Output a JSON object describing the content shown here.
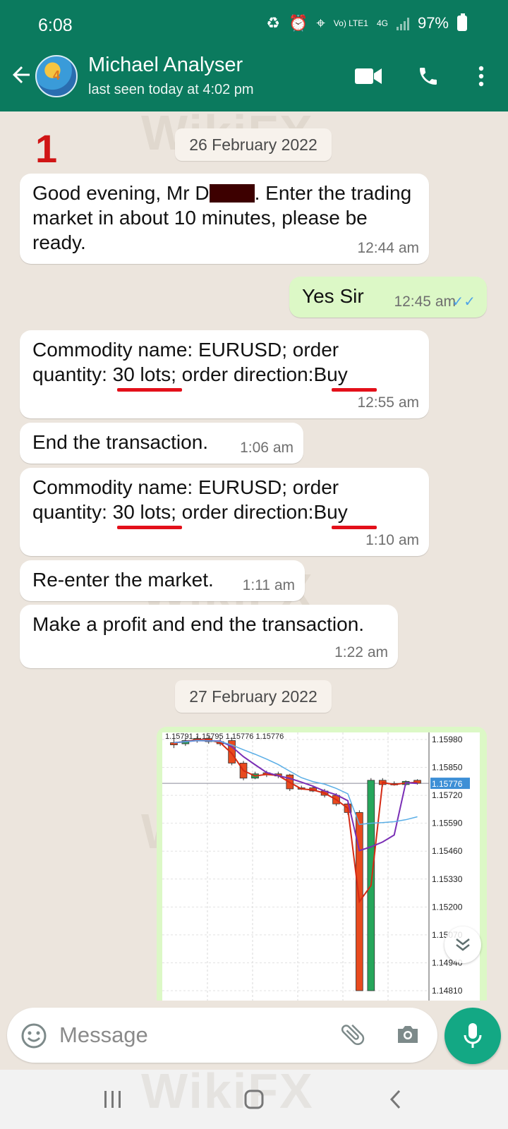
{
  "status_bar": {
    "time": "6:08",
    "battery": "97%",
    "network": "4G",
    "volte": "Vo) LTE1"
  },
  "header": {
    "contact_name": "Michael Analyser",
    "last_seen": "last seen today at 4:02 pm",
    "avatar_badge": "4"
  },
  "chat": {
    "marker": "1",
    "date1": "26 February 2022",
    "date2": "27 February 2022",
    "messages": [
      {
        "pre": "Good evening, Mr D",
        "post": ". Enter the trading market in about 10 minutes, please be ready.",
        "time": "12:44 am"
      },
      {
        "text": "Yes Sir",
        "time": "12:45 am"
      },
      {
        "line1": "Commodity name: EURUSD; order",
        "line2": "quantity: 30 lots; order direction:Buy",
        "time": "12:55 am"
      },
      {
        "text": "End the transaction.",
        "time": "1:06 am"
      },
      {
        "line1": "Commodity name: EURUSD; order",
        "line2": "quantity: 30 lots; order direction:Buy",
        "time": "1:10 am"
      },
      {
        "text": "Re-enter the market.",
        "time": "1:11 am"
      },
      {
        "text": "Make a profit and end the transaction.",
        "time": "1:22 am"
      }
    ]
  },
  "chart_data": {
    "type": "candlestick",
    "top_labels": "1.15791 1.15795 1.15776 1.15776",
    "y_ticks": [
      "1.15980",
      "1.15850",
      "1.15720",
      "1.15590",
      "1.15460",
      "1.15330",
      "1.15200",
      "1.15070",
      "1.14940",
      "1.14810"
    ],
    "current_price": "1.15776",
    "ylim": [
      1.1481,
      1.1598
    ],
    "candles": [
      {
        "o": 1.15955,
        "c": 1.15965,
        "h": 1.15985,
        "l": 1.1594,
        "dir": "down"
      },
      {
        "o": 1.1596,
        "c": 1.15975,
        "h": 1.1599,
        "l": 1.1595,
        "dir": "up"
      },
      {
        "o": 1.15975,
        "c": 1.15985,
        "h": 1.15995,
        "l": 1.15965,
        "dir": "up"
      },
      {
        "o": 1.15985,
        "c": 1.1597,
        "h": 1.15995,
        "l": 1.1596,
        "dir": "down"
      },
      {
        "o": 1.1597,
        "c": 1.1596,
        "h": 1.15985,
        "l": 1.1595,
        "dir": "down"
      },
      {
        "o": 1.15975,
        "c": 1.1587,
        "h": 1.1599,
        "l": 1.1586,
        "dir": "down"
      },
      {
        "o": 1.1587,
        "c": 1.158,
        "h": 1.1588,
        "l": 1.1579,
        "dir": "down"
      },
      {
        "o": 1.158,
        "c": 1.1582,
        "h": 1.1583,
        "l": 1.15795,
        "dir": "up"
      },
      {
        "o": 1.15825,
        "c": 1.15815,
        "h": 1.15835,
        "l": 1.15805,
        "dir": "down"
      },
      {
        "o": 1.1582,
        "c": 1.1581,
        "h": 1.1583,
        "l": 1.158,
        "dir": "down"
      },
      {
        "o": 1.15815,
        "c": 1.1575,
        "h": 1.1582,
        "l": 1.1574,
        "dir": "down"
      },
      {
        "o": 1.15755,
        "c": 1.1575,
        "h": 1.15765,
        "l": 1.15745,
        "dir": "down"
      },
      {
        "o": 1.15755,
        "c": 1.1574,
        "h": 1.15765,
        "l": 1.15735,
        "dir": "down"
      },
      {
        "o": 1.1574,
        "c": 1.1572,
        "h": 1.1575,
        "l": 1.1571,
        "dir": "down"
      },
      {
        "o": 1.1572,
        "c": 1.1568,
        "h": 1.1573,
        "l": 1.1567,
        "dir": "down"
      },
      {
        "o": 1.1568,
        "c": 1.1564,
        "h": 1.1569,
        "l": 1.1563,
        "dir": "down"
      },
      {
        "o": 1.1564,
        "c": 1.1481,
        "h": 1.1565,
        "l": 1.1481,
        "dir": "down"
      },
      {
        "o": 1.1481,
        "c": 1.1579,
        "h": 1.158,
        "l": 1.1481,
        "dir": "up"
      },
      {
        "o": 1.1579,
        "c": 1.1577,
        "h": 1.158,
        "l": 1.1576,
        "dir": "down"
      },
      {
        "o": 1.15775,
        "c": 1.1577,
        "h": 1.15785,
        "l": 1.15765,
        "dir": "down"
      },
      {
        "o": 1.1577,
        "c": 1.15785,
        "h": 1.1579,
        "l": 1.15765,
        "dir": "up"
      },
      {
        "o": 1.1579,
        "c": 1.15776,
        "h": 1.15795,
        "l": 1.1577,
        "dir": "down"
      }
    ]
  },
  "composer": {
    "placeholder": "Message"
  },
  "colors": {
    "header": "#0b7a5e",
    "outgoing": "#dcf8c6",
    "accent": "#13a884",
    "underline": "#e3101a"
  },
  "icons": [
    "back-arrow-icon",
    "video-call-icon",
    "phone-icon",
    "more-vertical-icon",
    "emoji-icon",
    "attach-icon",
    "camera-icon",
    "mic-icon",
    "scroll-down-icon"
  ]
}
